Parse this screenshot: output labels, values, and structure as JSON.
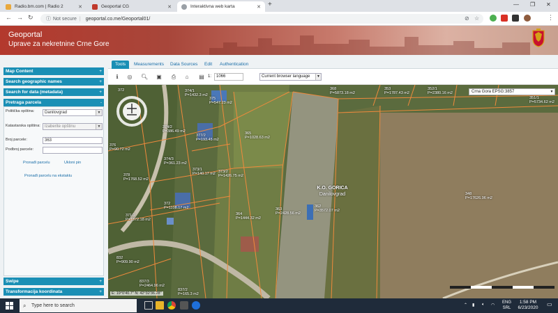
{
  "browser": {
    "tabs": [
      {
        "label": "Radio.bm.com | Radio 2",
        "favicon_color": "#e9a83c"
      },
      {
        "label": "Geoportal CG",
        "favicon_color": "#c0392b"
      },
      {
        "label": "Interaktivna web karta",
        "favicon_color": "#5f6368"
      }
    ],
    "new_tab_label": "+",
    "security_label": "Not secure",
    "url": "geoportal.co.me/Geoportal01/"
  },
  "site": {
    "title_line1": "Geoportal",
    "title_line2": "Uprave za nekretnine Crne Gore"
  },
  "left_panel": {
    "sections_top": [
      {
        "label": "Map Content",
        "icon": "+"
      },
      {
        "label": "Search geographic names",
        "icon": "+"
      },
      {
        "label": "Search for data (metadata)",
        "icon": "+"
      },
      {
        "label": "Pretraga parcela",
        "icon": "-"
      }
    ],
    "sections_bottom": [
      {
        "label": "Swipe",
        "icon": "+"
      },
      {
        "label": "Transformacija koordinata",
        "icon": "+"
      }
    ],
    "form": {
      "municipality_label": "Politička opština:",
      "municipality_value": "Danilovgrad",
      "cadastral_label": "Katastarska opština:",
      "cadastral_value": "Izaberite opštinu",
      "parcel_label": "Broj parcele:",
      "parcel_value": "363",
      "subparcel_label": "Podbroj parcele:",
      "subparcel_value": "",
      "find_link": "Pronađi parcelu",
      "remove_link": "Ukloni pin",
      "snapshot_link": "Pronađi parcelu na ekstaktu"
    }
  },
  "map_tabs": [
    "Tools",
    "Measurements",
    "Data Sources",
    "Edit",
    "Authentication"
  ],
  "tools": {
    "scale_label": "1:",
    "scale_value": "1066",
    "language": "Current browser language",
    "icons": [
      "info-icon",
      "globe-icon",
      "zoom-icon",
      "save-icon",
      "print-icon",
      "home-icon",
      "layers-icon",
      "scale-icon"
    ]
  },
  "map": {
    "crs": "Crna Gora EPSG:3857",
    "coords": "E: 19°0'40.7\"  N: 42°32'36.28\"",
    "place_name": "K.O. GORICA",
    "place_sub": "Danilovgrad",
    "parcel_labels": [
      {
        "num": "372",
        "area": "P=..."
      },
      {
        "num": "374/1",
        "area": "P=1432.3 m2"
      },
      {
        "num": "375",
        "area": "P=547.23 m2"
      },
      {
        "num": "368",
        "area": "P=5873.18 m2"
      },
      {
        "num": "353",
        "area": "P=1787.43 m2"
      },
      {
        "num": "352/1",
        "area": "P=2380.16 m2"
      },
      {
        "num": "351/1",
        "area": "P=5734.62 m2"
      },
      {
        "num": "374/2",
        "area": "P=386.49 m2"
      },
      {
        "num": "377/2",
        "area": "P=193.45 m2"
      },
      {
        "num": "365",
        "area": "P=1028.63 m2"
      },
      {
        "num": "376",
        "area": "P=90.72 m2"
      },
      {
        "num": "374/3",
        "area": "P=361.23 m2"
      },
      {
        "num": "373/1",
        "area": "P=140.17 m2"
      },
      {
        "num": "373/2",
        "area": "P=1426.75 m2"
      },
      {
        "num": "378",
        "area": "P=1768.52 m2"
      },
      {
        "num": "372",
        "area": "P=1108.17 m2"
      },
      {
        "num": "371/2",
        "area": "P=1872.18 m2"
      },
      {
        "num": "364",
        "area": "P=1444.32 m2"
      },
      {
        "num": "363",
        "area": "P=2428.56 m2"
      },
      {
        "num": "362",
        "area": "P=3572.07 m2"
      },
      {
        "num": "348",
        "area": "P=17626.96 m2"
      },
      {
        "num": "832",
        "area": "P=909.90 m2"
      },
      {
        "num": "837/3",
        "area": "P=2464.96 m2"
      },
      {
        "num": "837/2",
        "area": "P=165.3 m2"
      }
    ]
  },
  "taskbar": {
    "search_placeholder": "Type here to search",
    "lang_top": "ENG",
    "lang_bottom": "SRL",
    "time": "1:58 PM",
    "date": "6/23/2020"
  },
  "colors": {
    "accent": "#1a8fb5",
    "parcel_line": "#f08a3c",
    "banner": "#b3392d"
  }
}
